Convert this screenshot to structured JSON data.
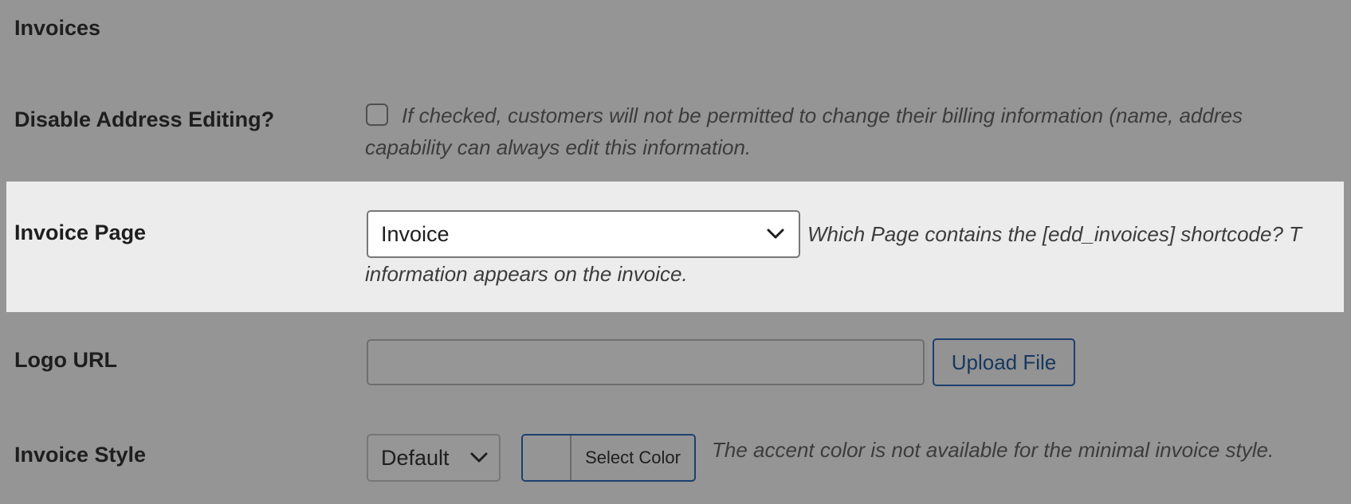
{
  "section": {
    "title": "Invoices"
  },
  "rows": {
    "disable_address": {
      "label": "Disable Address Editing?",
      "checked": false,
      "description_line1": "If checked, customers will not be permitted to change their billing information (name, addres",
      "description_line2": "capability can always edit this information."
    },
    "invoice_page": {
      "label": "Invoice Page",
      "selected": "Invoice",
      "description_line1": "Which Page contains the [edd_invoices] shortcode? T",
      "description_line2": "information appears on the invoice."
    },
    "logo_url": {
      "label": "Logo URL",
      "value": "",
      "upload_label": "Upload File"
    },
    "invoice_style": {
      "label": "Invoice Style",
      "selected": "Default",
      "color_button_label": "Select Color",
      "description": "The accent color is not available for the minimal invoice style."
    }
  },
  "icons": {
    "select_arrow": "chevron-down-icon"
  },
  "colors": {
    "background": "#959595",
    "highlight_row": "#ececec",
    "accent_border": "#1d3f6e"
  }
}
